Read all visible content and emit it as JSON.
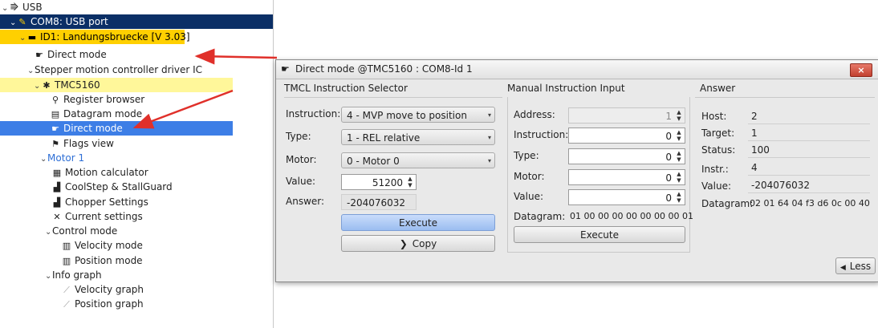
{
  "tree": {
    "usb": "USB",
    "com8": "COM8: USB port",
    "id1": "ID1: Landungsbruecke [V 3.03]",
    "direct_mode_top": "Direct mode",
    "stepper": "Stepper motion controller driver IC",
    "tmc5160": "TMC5160",
    "register_browser": "Register browser",
    "datagram_mode": "Datagram mode",
    "direct_mode": "Direct mode",
    "flags_view": "Flags view",
    "motor1": "Motor 1",
    "motion_calculator": "Motion calculator",
    "coolstep": "CoolStep & StallGuard",
    "chopper": "Chopper Settings",
    "current": "Current settings",
    "control_mode": "Control mode",
    "velocity_mode": "Velocity mode",
    "position_mode": "Position mode",
    "info_graph": "Info graph",
    "velocity_graph": "Velocity graph",
    "position_graph": "Position graph"
  },
  "window": {
    "title": "Direct mode @TMC5160 : COM8-Id 1",
    "close": "×"
  },
  "tmcl": {
    "title": "TMCL Instruction Selector",
    "instruction_label": "Instruction:",
    "instruction_value": "4 - MVP move to position",
    "type_label": "Type:",
    "type_value": "1 - REL relative",
    "motor_label": "Motor:",
    "motor_value": "0 - Motor 0",
    "value_label": "Value:",
    "value_value": "51200",
    "answer_label": "Answer:",
    "answer_value": "-204076032",
    "execute": "Execute",
    "copy": "Copy"
  },
  "manual": {
    "title": "Manual Instruction Input",
    "address_label": "Address:",
    "address_value": "1",
    "instruction_label": "Instruction:",
    "instruction_value": "0",
    "type_label": "Type:",
    "type_value": "0",
    "motor_label": "Motor:",
    "motor_value": "0",
    "value_label": "Value:",
    "value_value": "0",
    "datagram_label": "Datagram:",
    "datagram_value": "01 00 00 00 00 00 00 00 01",
    "execute": "Execute"
  },
  "answer": {
    "title": "Answer",
    "host_label": "Host:",
    "host_value": "2",
    "target_label": "Target:",
    "target_value": "1",
    "status_label": "Status:",
    "status_value": "100",
    "instr_label": "Instr.:",
    "instr_value": "4",
    "value_label": "Value:",
    "value_value": "-204076032",
    "datagram_label": "Datagram:",
    "datagram_value": "02 01 64 04 f3 d6 0c 00 40"
  },
  "less_button": "Less",
  "colors": {
    "com_highlight": "#0b2f66",
    "id_highlight": "#ffd000",
    "tmc_highlight": "#fff79a",
    "selected": "#3d7ee6",
    "arrow": "#e0302a"
  }
}
